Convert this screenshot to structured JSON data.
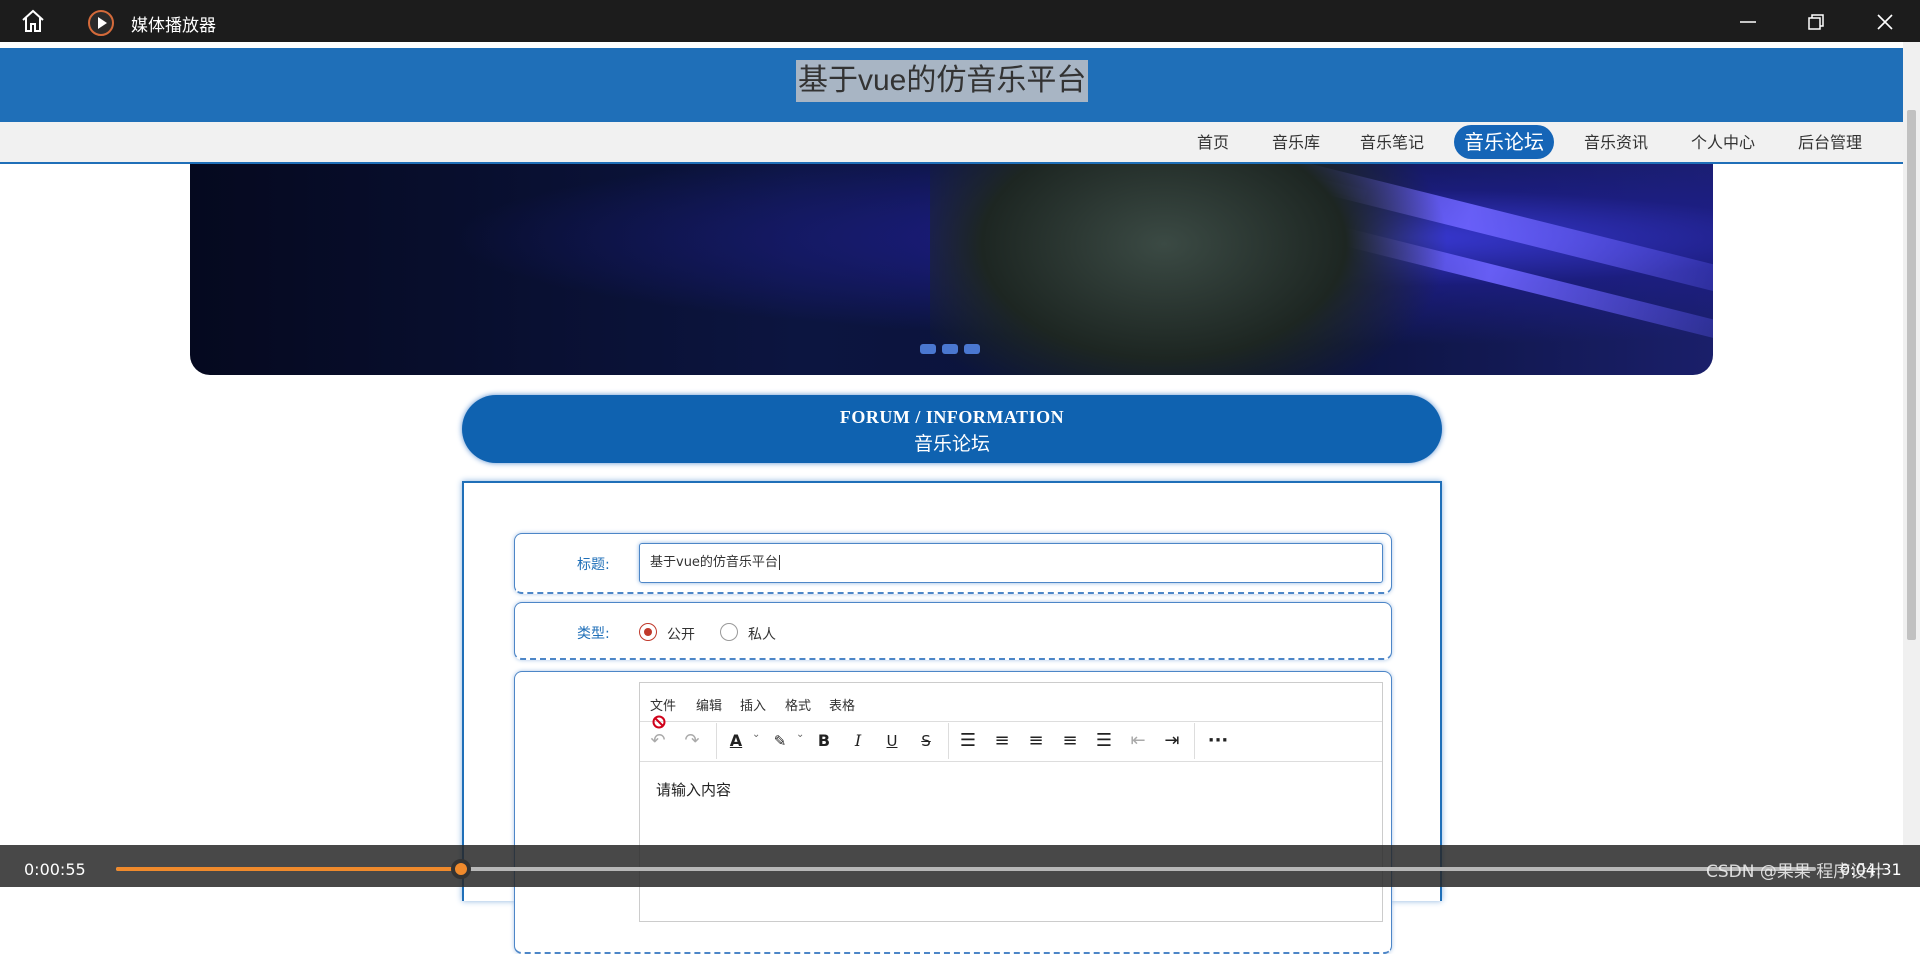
{
  "window": {
    "app_title": "媒体播放器",
    "icons": [
      "home-icon",
      "media-player-icon",
      "minimize-icon",
      "restore-icon",
      "close-icon"
    ]
  },
  "site": {
    "title": "基于vue的仿音乐平台",
    "nav": [
      {
        "label": "首页"
      },
      {
        "label": "音乐库"
      },
      {
        "label": "音乐笔记"
      },
      {
        "label": "音乐论坛",
        "active": true
      },
      {
        "label": "音乐资讯"
      },
      {
        "label": "个人中心"
      },
      {
        "label": "后台管理"
      }
    ],
    "carousel": {
      "slides": 3
    }
  },
  "forum_header": {
    "en": "FORUM / INFORMATION",
    "cn": "音乐论坛"
  },
  "form": {
    "title_label": "标题:",
    "title_value": "基于vue的仿音乐平台",
    "type_label": "类型:",
    "type_options": [
      {
        "label": "公开",
        "selected": true
      },
      {
        "label": "私人",
        "selected": false
      }
    ],
    "editor": {
      "menus": [
        "文件",
        "编辑",
        "插入",
        "格式",
        "表格"
      ],
      "tools": [
        "undo-icon",
        "redo-icon",
        "font-color-icon",
        "highlight-color-icon",
        "bold-icon",
        "italic-icon",
        "underline-icon",
        "strikethrough-icon",
        "line-height-icon",
        "align-left-icon",
        "align-center-icon",
        "align-right-icon",
        "justify-icon",
        "outdent-icon",
        "indent-icon",
        "more-icon"
      ],
      "placeholder": "请输入内容"
    }
  },
  "player": {
    "elapsed": "0:00:55",
    "total": "0:04:31",
    "progress": 0.203,
    "watermark": "CSDN @果果 程序设计",
    "accent": "#f08a2c"
  },
  "colors": {
    "header_blue": "#1f6fb8",
    "nav_active": "#1565b7",
    "forum_blue": "#0f62b0"
  }
}
